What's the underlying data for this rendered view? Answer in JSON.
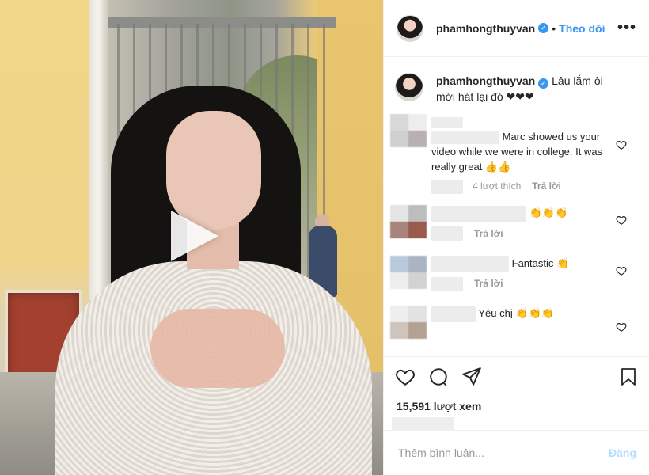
{
  "post": {
    "username": "phamhongthuyvan",
    "follow_label": "Theo dõi",
    "dot": "•",
    "more_label": "•••"
  },
  "caption": {
    "username": "phamhongthuyvan",
    "text": "Lâu lắm òi mới hát lại đó ❤❤❤"
  },
  "comments": [
    {
      "text": "Marc showed us your video while we were in college. It was really great 👍👍",
      "likes": "4 lượt thích",
      "reply": "Trả lời",
      "avatar_colors": [
        "#d8d8d8",
        "#ededed",
        "#cfcfcf",
        "#b8b0b2"
      ]
    },
    {
      "text": "👏👏👏",
      "likes": "",
      "reply": "Trả lời",
      "avatar_colors": [
        "#e4e4e4",
        "#bdbdbd",
        "#a8847c",
        "#9b5a4e"
      ]
    },
    {
      "text": "Fantastic 👏",
      "likes": "",
      "reply": "Trả lời",
      "avatar_colors": [
        "#b9c9dc",
        "#aab4c2",
        "#ededed",
        "#d2d2d2"
      ]
    },
    {
      "text": "Yêu chị 👏👏👏",
      "likes": "",
      "reply": "Trả lời",
      "avatar_colors": [
        "#eeeeee",
        "#e2e2e2",
        "#cfc4bb",
        "#b3a292"
      ]
    }
  ],
  "stats": {
    "views": "15,591 lượt xem"
  },
  "add_comment": {
    "placeholder": "Thêm bình luận...",
    "post_label": "Đăng"
  },
  "colors": {
    "accent": "#3897f0",
    "verified": "#3897f0",
    "post_disabled": "#b2dffc"
  },
  "icons": [
    "play-icon",
    "verified-icon",
    "more-icon",
    "heart-icon",
    "comment-icon",
    "share-icon",
    "bookmark-icon"
  ]
}
